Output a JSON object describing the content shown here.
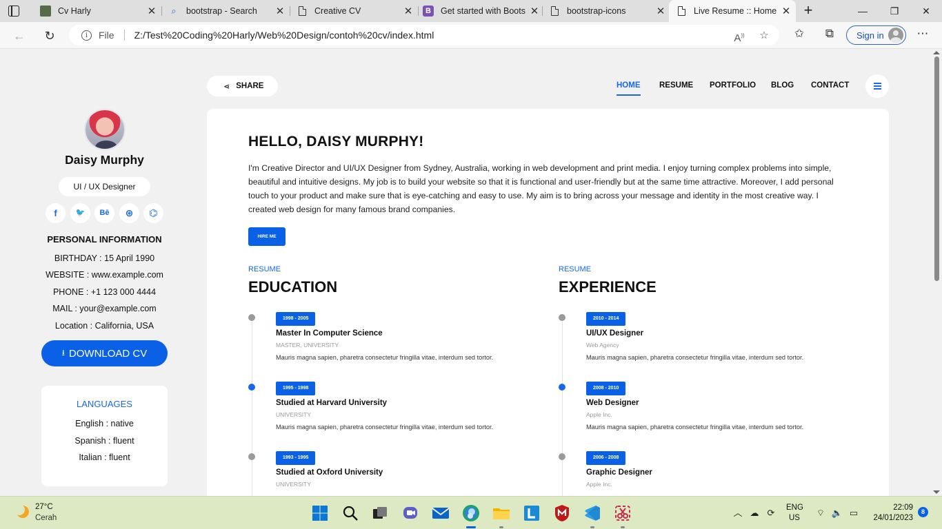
{
  "browser": {
    "tabs": [
      {
        "title": "Cv Harly"
      },
      {
        "title": "bootstrap - Search"
      },
      {
        "title": "Creative CV"
      },
      {
        "title": "Get started with Boots"
      },
      {
        "title": "bootstrap-icons"
      },
      {
        "title": "Live Resume :: Home"
      }
    ],
    "url_scheme_label": "File",
    "url": "Z:/Test%20Coding%20Harly/Web%20Design/contoh%20cv/index.html",
    "signin_label": "Sign in"
  },
  "sidebar": {
    "name": "Daisy Murphy",
    "role": "UI / UX Designer",
    "socials": [
      {
        "icon": "facebook-icon",
        "glyph": "f"
      },
      {
        "icon": "twitter-icon",
        "glyph": "🐦"
      },
      {
        "icon": "behance-icon",
        "glyph": "Bē"
      },
      {
        "icon": "dribbble-icon",
        "glyph": "⊛"
      },
      {
        "icon": "github-icon",
        "glyph": "⌬"
      }
    ],
    "personal_title": "PERSONAL INFORMATION",
    "personal": [
      "BIRTHDAY : 15 April 1990",
      "WEBSITE : www.example.com",
      "PHONE : +1 123 000 4444",
      "MAIL : your@example.com",
      "Location : California, USA"
    ],
    "download_label": "DOWNLOAD CV",
    "languages_title": "LANGUAGES",
    "languages": [
      "English : native",
      "Spanish : fluent",
      "Italian : fluent"
    ]
  },
  "topnav": {
    "share_label": "SHARE",
    "links": [
      "HOME",
      "RESUME",
      "PORTFOLIO",
      "BLOG",
      "CONTACT"
    ],
    "active": "HOME"
  },
  "main": {
    "hello": "HELLO, DAISY MURPHY!",
    "intro": "I'm Creative Director and UI/UX Designer from Sydney, Australia, working in web development and print media. I enjoy turning complex problems into simple, beautiful and intuitive designs. My job is to build your website so that it is functional and user-friendly but at the same time attractive. Moreover, I add personal touch to your product and make sure that is eye-catching and easy to use. My aim is to bring across your message and identity in the most creative way. I created web design for many famous brand companies.",
    "hire_label": "HIRE ME",
    "education": {
      "kicker": "RESUME",
      "title": "EDUCATION",
      "items": [
        {
          "years": "1998 - 2005",
          "title": "Master In Computer Science",
          "sub": "MASTER, UNIVERSITY",
          "desc": "Mauris magna sapien, pharetra consectetur fringilla vitae, interdum sed tortor."
        },
        {
          "years": "1995 - 1998",
          "title": "Studied at Harvard University",
          "sub": "UNIVERSITY",
          "desc": "Mauris magna sapien, pharetra consectetur fringilla vitae, interdum sed tortor."
        },
        {
          "years": "1993 - 1995",
          "title": "Studied at Oxford University",
          "sub": "UNIVERSITY",
          "desc": ""
        }
      ]
    },
    "experience": {
      "kicker": "RESUME",
      "title": "EXPERIENCE",
      "items": [
        {
          "years": "2010 - 2014",
          "title": "UI/UX Designer",
          "sub": "Web Agency",
          "desc": "Mauris magna sapien, pharetra consectetur fringilla vitae, interdum sed tortor."
        },
        {
          "years": "2008 - 2010",
          "title": "Web Designer",
          "sub": "Apple Inc.",
          "desc": "Mauris magna sapien, pharetra consectetur fringilla vitae, interdum sed tortor."
        },
        {
          "years": "2006 - 2008",
          "title": "Graphic Designer",
          "sub": "Apple Inc.",
          "desc": ""
        }
      ]
    }
  },
  "taskbar": {
    "weather_temp": "27°C",
    "weather_cond": "Cerah",
    "lang_line1": "ENG",
    "lang_line2": "US",
    "time": "22:09",
    "date": "24/01/2023",
    "notifications": "8"
  },
  "colors": {
    "accent": "#0a61e6",
    "page_bg": "#f1f1f1",
    "taskbar_bg": "#dde9c2"
  }
}
